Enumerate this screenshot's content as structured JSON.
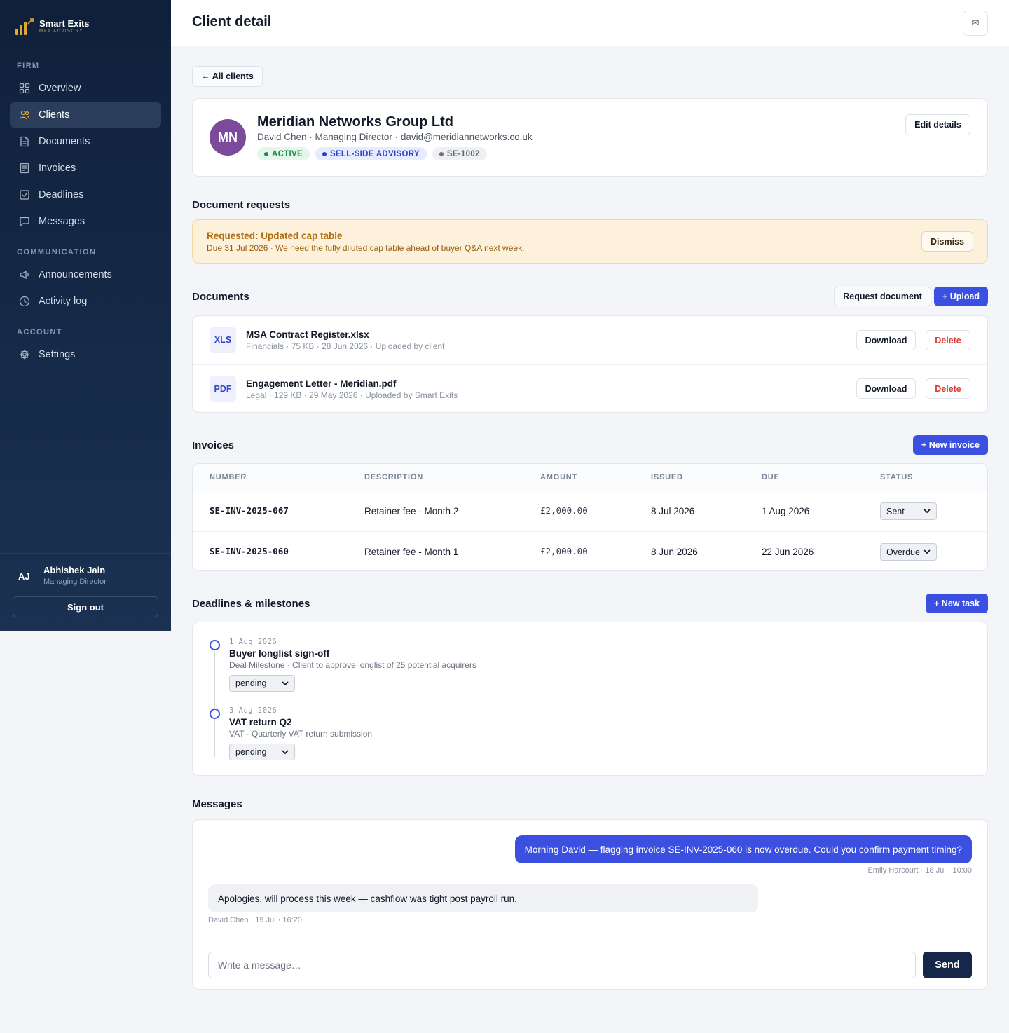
{
  "brand": {
    "name": "Smart Exits",
    "sub": "M&A ADVISORY"
  },
  "sidebar": {
    "sections": [
      {
        "label": "FIRM"
      },
      {
        "label": "COMMUNICATION"
      },
      {
        "label": "ACCOUNT"
      }
    ],
    "items": [
      {
        "label": "Overview",
        "icon": "grid-icon"
      },
      {
        "label": "Clients",
        "icon": "users-icon",
        "active": true
      },
      {
        "label": "Documents",
        "icon": "document-icon"
      },
      {
        "label": "Invoices",
        "icon": "invoice-icon"
      },
      {
        "label": "Deadlines",
        "icon": "checkbox-icon"
      },
      {
        "label": "Messages",
        "icon": "chat-icon"
      },
      {
        "label": "Announcements",
        "icon": "megaphone-icon"
      },
      {
        "label": "Activity log",
        "icon": "clock-icon"
      },
      {
        "label": "Settings",
        "icon": "gear-icon"
      }
    ],
    "user": {
      "initials": "AJ",
      "name": "Abhishek Jain",
      "role": "Managing Director",
      "signout": "Sign out"
    }
  },
  "header": {
    "title": "Client detail",
    "mail_icon": "✉"
  },
  "back_label": "← All clients",
  "client": {
    "initials": "MN",
    "name": "Meridian Networks Group Ltd",
    "subtitle": "David Chen · Managing Director · david@meridiannetworks.co.uk",
    "badges": [
      "ACTIVE",
      "SELL-SIDE ADVISORY",
      "SE-1002"
    ],
    "edit_label": "Edit details",
    "avatar_color": "#7b4a9b"
  },
  "requests": {
    "title": "Document requests",
    "item": {
      "title": "Requested: Updated cap table",
      "text": "Due 31 Jul 2026 · We need the fully diluted cap table ahead of buyer Q&A next week.",
      "dismiss": "Dismiss"
    }
  },
  "documents": {
    "title": "Documents",
    "request_label": "Request document",
    "upload_label": "+ Upload",
    "download_label": "Download",
    "delete_label": "Delete",
    "items": [
      {
        "type": "XLS",
        "name": "MSA Contract Register.xlsx",
        "meta": "Financials · 75 KB · 28 Jun 2026 · Uploaded by client"
      },
      {
        "type": "PDF",
        "name": "Engagement Letter - Meridian.pdf",
        "meta": "Legal · 129 KB · 29 May 2026 · Uploaded by Smart Exits"
      }
    ]
  },
  "invoices": {
    "title": "Invoices",
    "new_label": "+ New invoice",
    "columns": [
      "NUMBER",
      "DESCRIPTION",
      "AMOUNT",
      "ISSUED",
      "DUE",
      "STATUS"
    ],
    "rows": [
      {
        "number": "SE-INV-2025-067",
        "description": "Retainer fee - Month 2",
        "amount": "£2,000.00",
        "issued": "8 Jul 2026",
        "due": "1 Aug 2026",
        "status": "Sent"
      },
      {
        "number": "SE-INV-2025-060",
        "description": "Retainer fee - Month 1",
        "amount": "£2,000.00",
        "issued": "8 Jun 2026",
        "due": "22 Jun 2026",
        "status": "Overdue"
      }
    ]
  },
  "deadlines": {
    "title": "Deadlines & milestones",
    "new_label": "+ New task",
    "items": [
      {
        "date": "1 Aug 2026",
        "title": "Buyer longlist sign-off",
        "desc": "Deal Milestone · Client to approve longlist of 25 potential acquirers",
        "status": "pending"
      },
      {
        "date": "3 Aug 2026",
        "title": "VAT return Q2",
        "desc": "VAT · Quarterly VAT return submission",
        "status": "pending"
      }
    ]
  },
  "messages": {
    "title": "Messages",
    "outgoing": {
      "text": "Morning David — flagging invoice SE-INV-2025-060 is now overdue. Could you confirm payment timing?",
      "meta": "Emily Harcourt · 18 Jul · 10:00"
    },
    "incoming": {
      "text": "Apologies, will process this week — cashflow was tight post payroll run.",
      "meta": "David Chen · 19 Jul · 16:20"
    },
    "placeholder": "Write a message…",
    "send_label": "Send"
  },
  "colors": {
    "primary": "#3b4fe0",
    "sidebar": "#0f203a",
    "accent": "#e0a73a",
    "danger": "#dc3b31"
  }
}
